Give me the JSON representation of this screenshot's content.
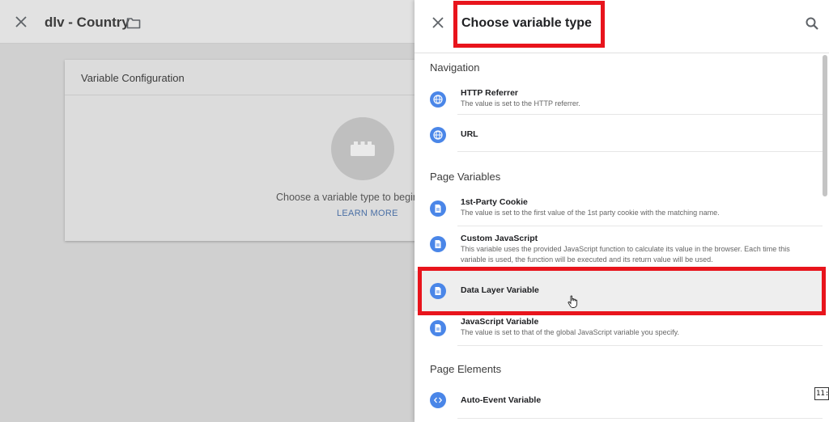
{
  "background": {
    "title": "dlv - Country",
    "card": {
      "header": "Variable Configuration",
      "prompt": "Choose a variable type to begin",
      "link": "LEARN MORE"
    }
  },
  "panel": {
    "title": "Choose variable type",
    "sections": [
      {
        "heading": "Navigation",
        "items": [
          {
            "name": "HTTP Referrer",
            "desc": "The value is set to the HTTP referrer."
          },
          {
            "name": "URL",
            "desc": ""
          }
        ]
      },
      {
        "heading": "Page Variables",
        "items": [
          {
            "name": "1st-Party Cookie",
            "desc": "The value is set to the first value of the 1st party cookie with the matching name."
          },
          {
            "name": "Custom JavaScript",
            "desc": "This variable uses the provided JavaScript function to calculate its value in the browser. Each time this variable is used, the function will be executed and its return value will be used."
          },
          {
            "name": "Data Layer Variable",
            "desc": ""
          },
          {
            "name": "JavaScript Variable",
            "desc": "The value is set to that of the global JavaScript variable you specify."
          }
        ]
      },
      {
        "heading": "Page Elements",
        "items": [
          {
            "name": "Auto-Event Variable",
            "desc": ""
          }
        ]
      }
    ]
  },
  "corner_badge": "11:",
  "colors": {
    "accent": "#4a86e8",
    "highlight_border": "#e8141c",
    "link": "#4a6fa5"
  }
}
